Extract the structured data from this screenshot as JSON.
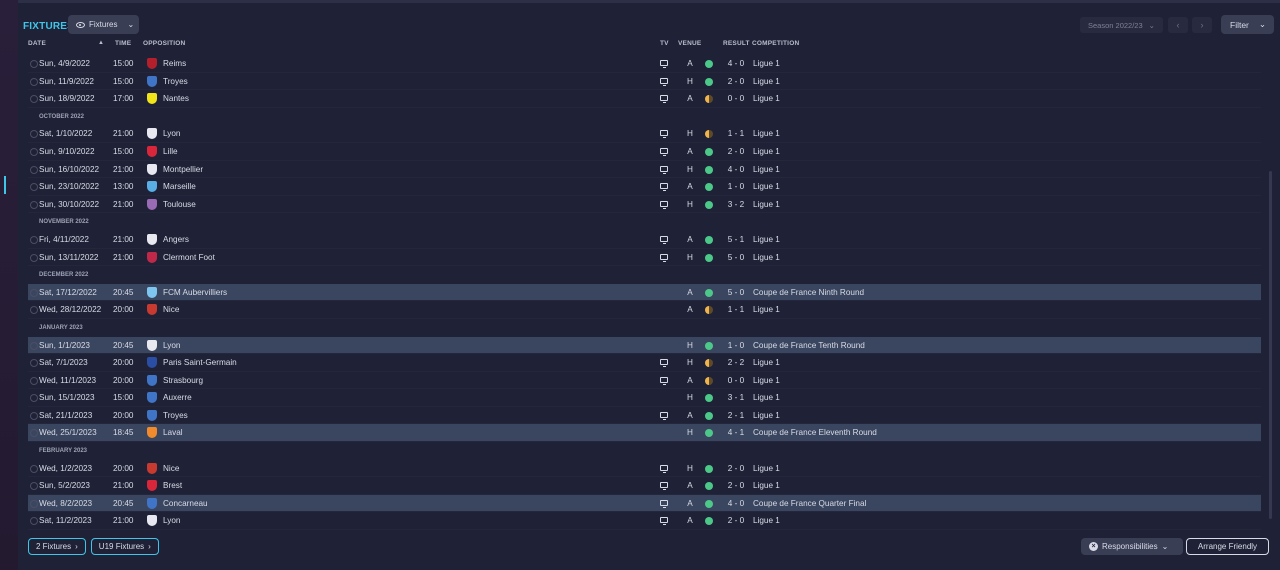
{
  "title": "FIXTURES",
  "view_button": {
    "label": "Fixtures"
  },
  "season": {
    "label": "Season 2022/23"
  },
  "filter": {
    "label": "Filter"
  },
  "columns": {
    "date": "DATE",
    "time": "TIME",
    "opposition": "OPPOSITION",
    "tv": "TV",
    "venue": "VENUE",
    "result": "RESULT",
    "competition": "COMPETITION"
  },
  "colors": {
    "accent": "#3fc6e8",
    "win": "#4cc889",
    "draw": "#f0b44c",
    "highlight_row": "#3a4660",
    "background": "#1f2236"
  },
  "rows": [
    {
      "type": "match",
      "date": "Sun, 4/9/2022",
      "time": "15:00",
      "opponent": "Reims",
      "badge_color": "#b3202c",
      "tv": true,
      "venue": "A",
      "outcome": "win",
      "score": "4 - 0",
      "competition": "Ligue 1",
      "highlight": false
    },
    {
      "type": "match",
      "date": "Sun, 11/9/2022",
      "time": "15:00",
      "opponent": "Troyes",
      "badge_color": "#3f74c7",
      "tv": true,
      "venue": "H",
      "outcome": "win",
      "score": "2 - 0",
      "competition": "Ligue 1",
      "highlight": false
    },
    {
      "type": "match",
      "date": "Sun, 18/9/2022",
      "time": "17:00",
      "opponent": "Nantes",
      "badge_color": "#f1e51a",
      "tv": true,
      "venue": "A",
      "outcome": "draw",
      "score": "0 - 0",
      "competition": "Ligue 1",
      "highlight": false
    },
    {
      "type": "month",
      "label": "OCTOBER 2022"
    },
    {
      "type": "match",
      "date": "Sat, 1/10/2022",
      "time": "21:00",
      "opponent": "Lyon",
      "badge_color": "#e8e8f0",
      "tv": true,
      "venue": "H",
      "outcome": "draw",
      "score": "1 - 1",
      "competition": "Ligue 1",
      "highlight": false
    },
    {
      "type": "match",
      "date": "Sun, 9/10/2022",
      "time": "15:00",
      "opponent": "Lille",
      "badge_color": "#d9263a",
      "tv": true,
      "venue": "A",
      "outcome": "win",
      "score": "2 - 0",
      "competition": "Ligue 1",
      "highlight": false
    },
    {
      "type": "match",
      "date": "Sun, 16/10/2022",
      "time": "21:00",
      "opponent": "Montpellier",
      "badge_color": "#e8e8f0",
      "tv": true,
      "venue": "H",
      "outcome": "win",
      "score": "4 - 0",
      "competition": "Ligue 1",
      "highlight": false
    },
    {
      "type": "match",
      "date": "Sun, 23/10/2022",
      "time": "13:00",
      "opponent": "Marseille",
      "badge_color": "#5aaee6",
      "tv": true,
      "venue": "A",
      "outcome": "win",
      "score": "1 - 0",
      "competition": "Ligue 1",
      "highlight": false
    },
    {
      "type": "match",
      "date": "Sun, 30/10/2022",
      "time": "21:00",
      "opponent": "Toulouse",
      "badge_color": "#9a6bb5",
      "tv": true,
      "venue": "H",
      "outcome": "win",
      "score": "3 - 2",
      "competition": "Ligue 1",
      "highlight": false
    },
    {
      "type": "month",
      "label": "NOVEMBER 2022"
    },
    {
      "type": "match",
      "date": "Fri, 4/11/2022",
      "time": "21:00",
      "opponent": "Angers",
      "badge_color": "#e8e8f0",
      "tv": true,
      "venue": "A",
      "outcome": "win",
      "score": "5 - 1",
      "competition": "Ligue 1",
      "highlight": false
    },
    {
      "type": "match",
      "date": "Sun, 13/11/2022",
      "time": "21:00",
      "opponent": "Clermont Foot",
      "badge_color": "#c0284a",
      "tv": true,
      "venue": "H",
      "outcome": "win",
      "score": "5 - 0",
      "competition": "Ligue 1",
      "highlight": false
    },
    {
      "type": "month",
      "label": "DECEMBER 2022"
    },
    {
      "type": "match",
      "date": "Sat, 17/12/2022",
      "time": "20:45",
      "opponent": "FCM Aubervilliers",
      "badge_color": "#7ec6ef",
      "tv": false,
      "venue": "A",
      "outcome": "win",
      "score": "5 - 0",
      "competition": "Coupe de France Ninth Round",
      "highlight": true
    },
    {
      "type": "match",
      "date": "Wed, 28/12/2022",
      "time": "20:00",
      "opponent": "Nice",
      "badge_color": "#c8392f",
      "tv": false,
      "venue": "A",
      "outcome": "draw",
      "score": "1 - 1",
      "competition": "Ligue 1",
      "highlight": false
    },
    {
      "type": "month",
      "label": "JANUARY 2023"
    },
    {
      "type": "match",
      "date": "Sun, 1/1/2023",
      "time": "20:45",
      "opponent": "Lyon",
      "badge_color": "#e8e8f0",
      "tv": false,
      "venue": "H",
      "outcome": "win",
      "score": "1 - 0",
      "competition": "Coupe de France Tenth Round",
      "highlight": true
    },
    {
      "type": "match",
      "date": "Sat, 7/1/2023",
      "time": "20:00",
      "opponent": "Paris Saint-Germain",
      "badge_color": "#2a4ea3",
      "tv": true,
      "venue": "H",
      "outcome": "draw",
      "score": "2 - 2",
      "competition": "Ligue 1",
      "highlight": false
    },
    {
      "type": "match",
      "date": "Wed, 11/1/2023",
      "time": "20:00",
      "opponent": "Strasbourg",
      "badge_color": "#3f74c7",
      "tv": true,
      "venue": "A",
      "outcome": "draw",
      "score": "0 - 0",
      "competition": "Ligue 1",
      "highlight": false
    },
    {
      "type": "match",
      "date": "Sun, 15/1/2023",
      "time": "15:00",
      "opponent": "Auxerre",
      "badge_color": "#3f74c7",
      "tv": false,
      "venue": "H",
      "outcome": "win",
      "score": "3 - 1",
      "competition": "Ligue 1",
      "highlight": false
    },
    {
      "type": "match",
      "date": "Sat, 21/1/2023",
      "time": "20:00",
      "opponent": "Troyes",
      "badge_color": "#3f74c7",
      "tv": true,
      "venue": "A",
      "outcome": "win",
      "score": "2 - 1",
      "competition": "Ligue 1",
      "highlight": false
    },
    {
      "type": "match",
      "date": "Wed, 25/1/2023",
      "time": "18:45",
      "opponent": "Laval",
      "badge_color": "#f08a2c",
      "tv": false,
      "venue": "H",
      "outcome": "win",
      "score": "4 - 1",
      "competition": "Coupe de France Eleventh Round",
      "highlight": true
    },
    {
      "type": "month",
      "label": "FEBRUARY 2023"
    },
    {
      "type": "match",
      "date": "Wed, 1/2/2023",
      "time": "20:00",
      "opponent": "Nice",
      "badge_color": "#c8392f",
      "tv": true,
      "venue": "H",
      "outcome": "win",
      "score": "2 - 0",
      "competition": "Ligue 1",
      "highlight": false
    },
    {
      "type": "match",
      "date": "Sun, 5/2/2023",
      "time": "21:00",
      "opponent": "Brest",
      "badge_color": "#d9263a",
      "tv": true,
      "venue": "A",
      "outcome": "win",
      "score": "2 - 0",
      "competition": "Ligue 1",
      "highlight": false
    },
    {
      "type": "match",
      "date": "Wed, 8/2/2023",
      "time": "20:45",
      "opponent": "Concarneau",
      "badge_color": "#3f74c7",
      "tv": true,
      "venue": "A",
      "outcome": "win",
      "score": "4 - 0",
      "competition": "Coupe de France Quarter Final",
      "highlight": true
    },
    {
      "type": "match",
      "date": "Sat, 11/2/2023",
      "time": "21:00",
      "opponent": "Lyon",
      "badge_color": "#e8e8f0",
      "tv": true,
      "venue": "A",
      "outcome": "win",
      "score": "2 - 0",
      "competition": "Ligue 1",
      "highlight": false
    }
  ],
  "footer": {
    "fixtures_link": "2 Fixtures",
    "u19_link": "U19 Fixtures",
    "responsibilities": "Responsibilities",
    "arrange_friendly": "Arrange Friendly"
  }
}
